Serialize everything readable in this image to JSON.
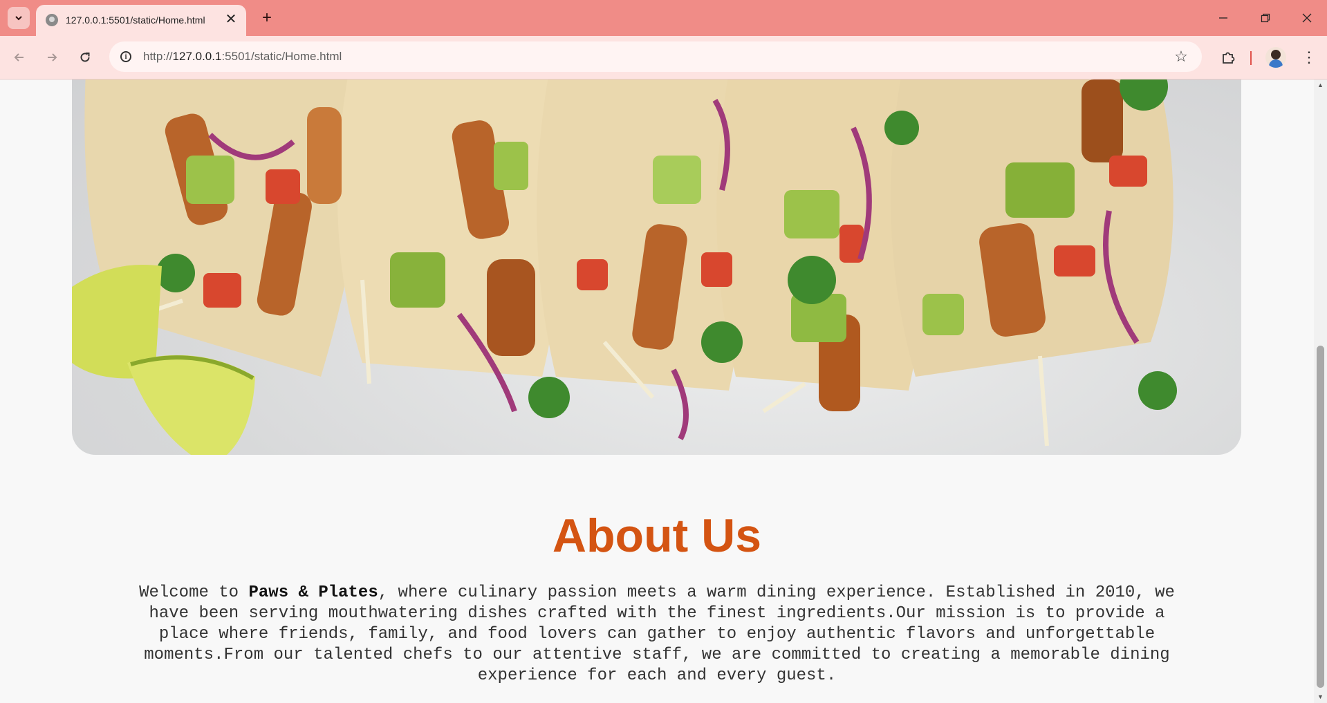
{
  "browser": {
    "tab_title": "127.0.0.1:5501/static/Home.html",
    "url_prefix": "http://",
    "url_host": "127.0.0.1",
    "url_rest": ":5501/static/Home.html"
  },
  "page": {
    "about": {
      "heading": "About Us",
      "text_intro": "Welcome to ",
      "brand": "Paws & Plates",
      "text_body": ", where culinary passion meets a warm dining experience. Established in 2010, we have been serving mouthwatering dishes crafted with the finest ingredients.Our mission is to provide a place where friends, family, and food lovers can gather to enjoy authentic flavors and unforgettable moments.From our talented chefs to our attentive staff, we are committed to creating a memorable dining experience for each and every guest."
    }
  },
  "colors": {
    "chrome_titlebar": "#f08c87",
    "chrome_toolbar": "#fde3e1",
    "heading_accent": "#d45412"
  },
  "icons": {
    "tab_search": "chevron-down-icon",
    "new_tab": "plus-icon",
    "back": "arrow-left-icon",
    "forward": "arrow-right-icon",
    "reload": "reload-icon",
    "site_info": "info-icon",
    "bookmark": "star-icon",
    "extensions": "puzzle-icon",
    "menu": "kebab-menu-icon"
  }
}
